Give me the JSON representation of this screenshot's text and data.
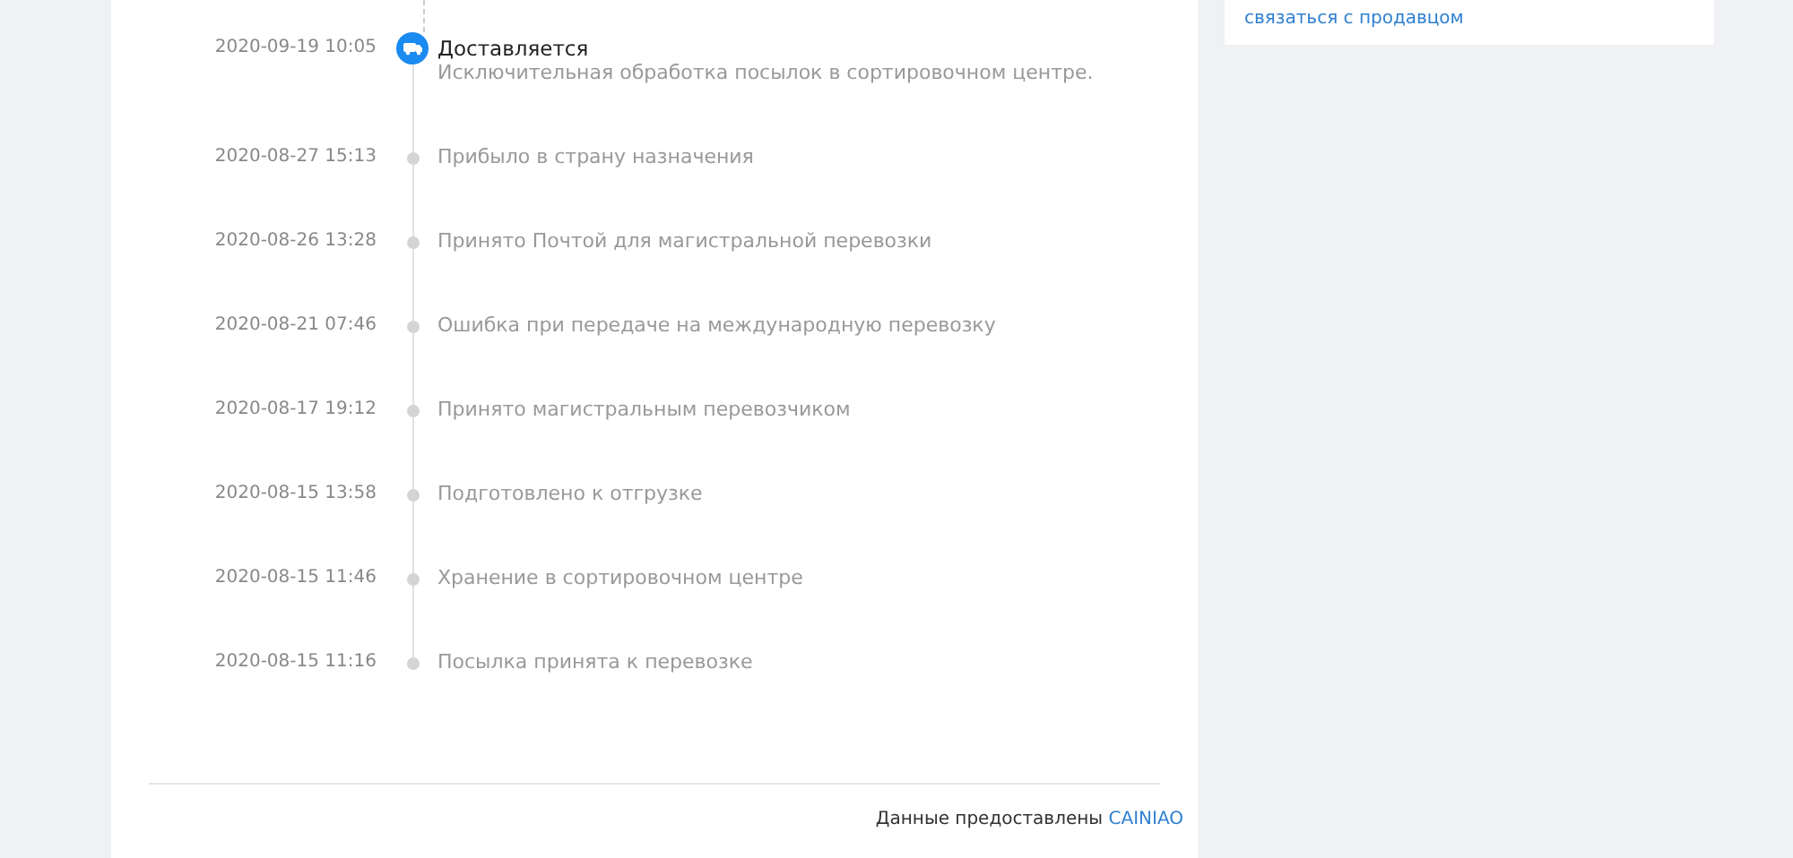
{
  "tracking": {
    "events": [
      {
        "time": "2020-09-19 10:05",
        "title": "Доставляется",
        "description": "Исключительная обработка посылок в сортировочном центре.",
        "current": true
      },
      {
        "time": "2020-08-27 15:13",
        "title": "Прибыло в страну назначения",
        "current": false
      },
      {
        "time": "2020-08-26 13:28",
        "title": "Принято Почтой для магистральной перевозки",
        "current": false
      },
      {
        "time": "2020-08-21 07:46",
        "title": "Ошибка при передаче на международную перевозку",
        "current": false
      },
      {
        "time": "2020-08-17 19:12",
        "title": "Принято магистральным перевозчиком",
        "current": false
      },
      {
        "time": "2020-08-15 13:58",
        "title": "Подготовлено к отгрузке",
        "current": false
      },
      {
        "time": "2020-08-15 11:46",
        "title": "Хранение в сортировочном центре",
        "current": false
      },
      {
        "time": "2020-08-15 11:16",
        "title": "Посылка принята к перевозке",
        "current": false
      }
    ],
    "footer": {
      "text": "Данные предоставлены",
      "provider": "CAINIAO"
    }
  },
  "sidebar": {
    "link": "связаться с продавцом"
  }
}
